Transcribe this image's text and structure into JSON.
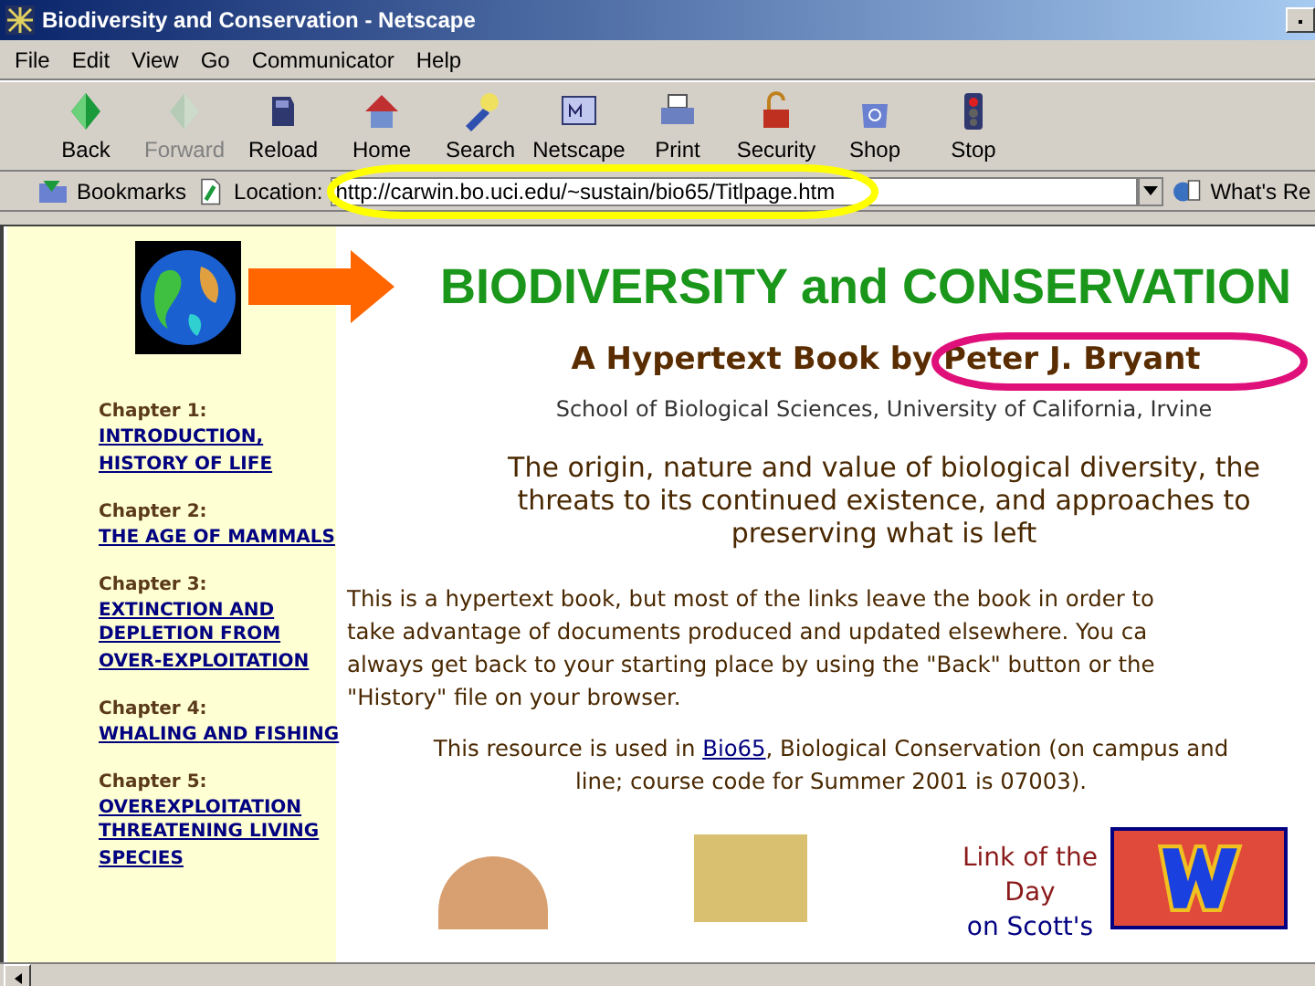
{
  "window": {
    "title": "Biodiversity and Conservation - Netscape"
  },
  "menu": [
    "File",
    "Edit",
    "View",
    "Go",
    "Communicator",
    "Help"
  ],
  "toolbar": [
    {
      "label": "Back",
      "disabled": false
    },
    {
      "label": "Forward",
      "disabled": true
    },
    {
      "label": "Reload",
      "disabled": false
    },
    {
      "label": "Home",
      "disabled": false
    },
    {
      "label": "Search",
      "disabled": false
    },
    {
      "label": "Netscape",
      "disabled": false
    },
    {
      "label": "Print",
      "disabled": false
    },
    {
      "label": "Security",
      "disabled": false
    },
    {
      "label": "Shop",
      "disabled": false
    },
    {
      "label": "Stop",
      "disabled": false
    }
  ],
  "location_bar": {
    "bookmarks": "Bookmarks",
    "location_label": "Location:",
    "url": "http://carwin.bo.uci.edu/~sustain/bio65/Titlpage.htm",
    "whats_related": "What's Re"
  },
  "sidebar": {
    "chapters": [
      {
        "heading": "Chapter 1:",
        "links": [
          "INTRODUCTION,",
          "HISTORY OF LIFE"
        ]
      },
      {
        "heading": "Chapter 2:",
        "links": [
          "THE AGE OF MAMMALS"
        ]
      },
      {
        "heading": "Chapter 3:",
        "links": [
          "EXTINCTION AND DEPLETION FROM",
          "OVER-EXPLOITATION"
        ]
      },
      {
        "heading": "Chapter 4:",
        "links": [
          "WHALING AND FISHING"
        ]
      },
      {
        "heading": "Chapter 5:",
        "links": [
          "OVEREXPLOITATION THREATENING LIVING",
          "SPECIES"
        ]
      }
    ]
  },
  "page": {
    "title": "BIODIVERSITY and CONSERVATION",
    "subtitle": "A Hypertext Book by Peter J. Bryant",
    "affiliation": "School of Biological Sciences, University of California, Irvine",
    "tagline": "The origin, nature and value of biological diversity, the threats to its continued existence, and approaches to preserving what is left",
    "intro_lines": [
      "This is a hypertext book, but most of the links leave the book in order to",
      "take advantage of documents produced and updated elsewhere. You ca",
      "always get back to your starting place by using the \"Back\" button or the",
      "\"History\" file on your browser."
    ],
    "resource": {
      "before": "This resource is used in ",
      "link": "Bio65",
      "after": ", Biological Conservation (on campus and",
      "line2": "line; course code for Summer 2001 is 07003)."
    },
    "link_of_the_day": {
      "label": "Link of the Day",
      "link": "on Scott's"
    }
  }
}
